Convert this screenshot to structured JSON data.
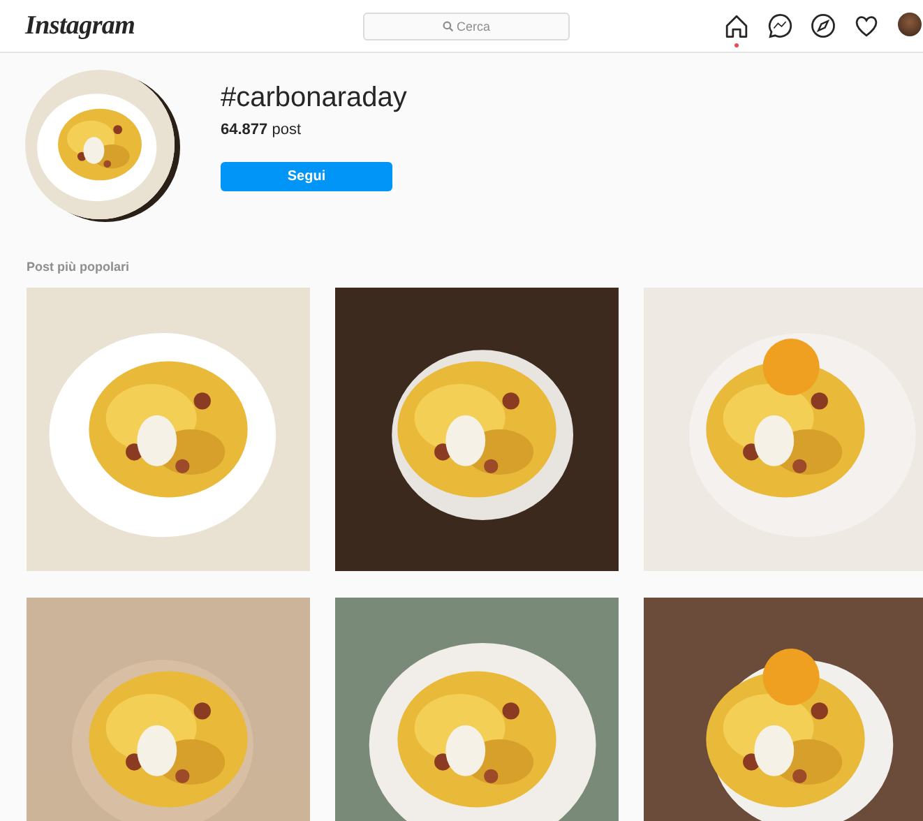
{
  "header": {
    "logo": "Instagram",
    "search": {
      "placeholder": "Cerca"
    },
    "nav_icons": [
      {
        "kind": "home",
        "selected": true
      },
      {
        "kind": "messenger",
        "selected": false
      },
      {
        "kind": "explore",
        "selected": false
      },
      {
        "kind": "activity",
        "selected": false
      },
      {
        "kind": "avatar",
        "selected": false
      }
    ]
  },
  "hashtag": {
    "title": "#carbonaraday",
    "count": "**64.877** post",
    "follow_button": "Segui"
  },
  "section_title": "Post più popolari"
}
